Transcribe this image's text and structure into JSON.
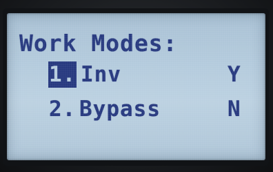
{
  "screen": {
    "title": "Work Modes:",
    "selected_index": 0,
    "items": [
      {
        "number": "1.",
        "label": "Inv",
        "value": "Y"
      },
      {
        "number": "2.",
        "label": "Bypass",
        "value": "N"
      }
    ]
  },
  "colors": {
    "lcd_background": "#b4cbdd",
    "text": "#27397f",
    "selection_background": "#27397f"
  }
}
